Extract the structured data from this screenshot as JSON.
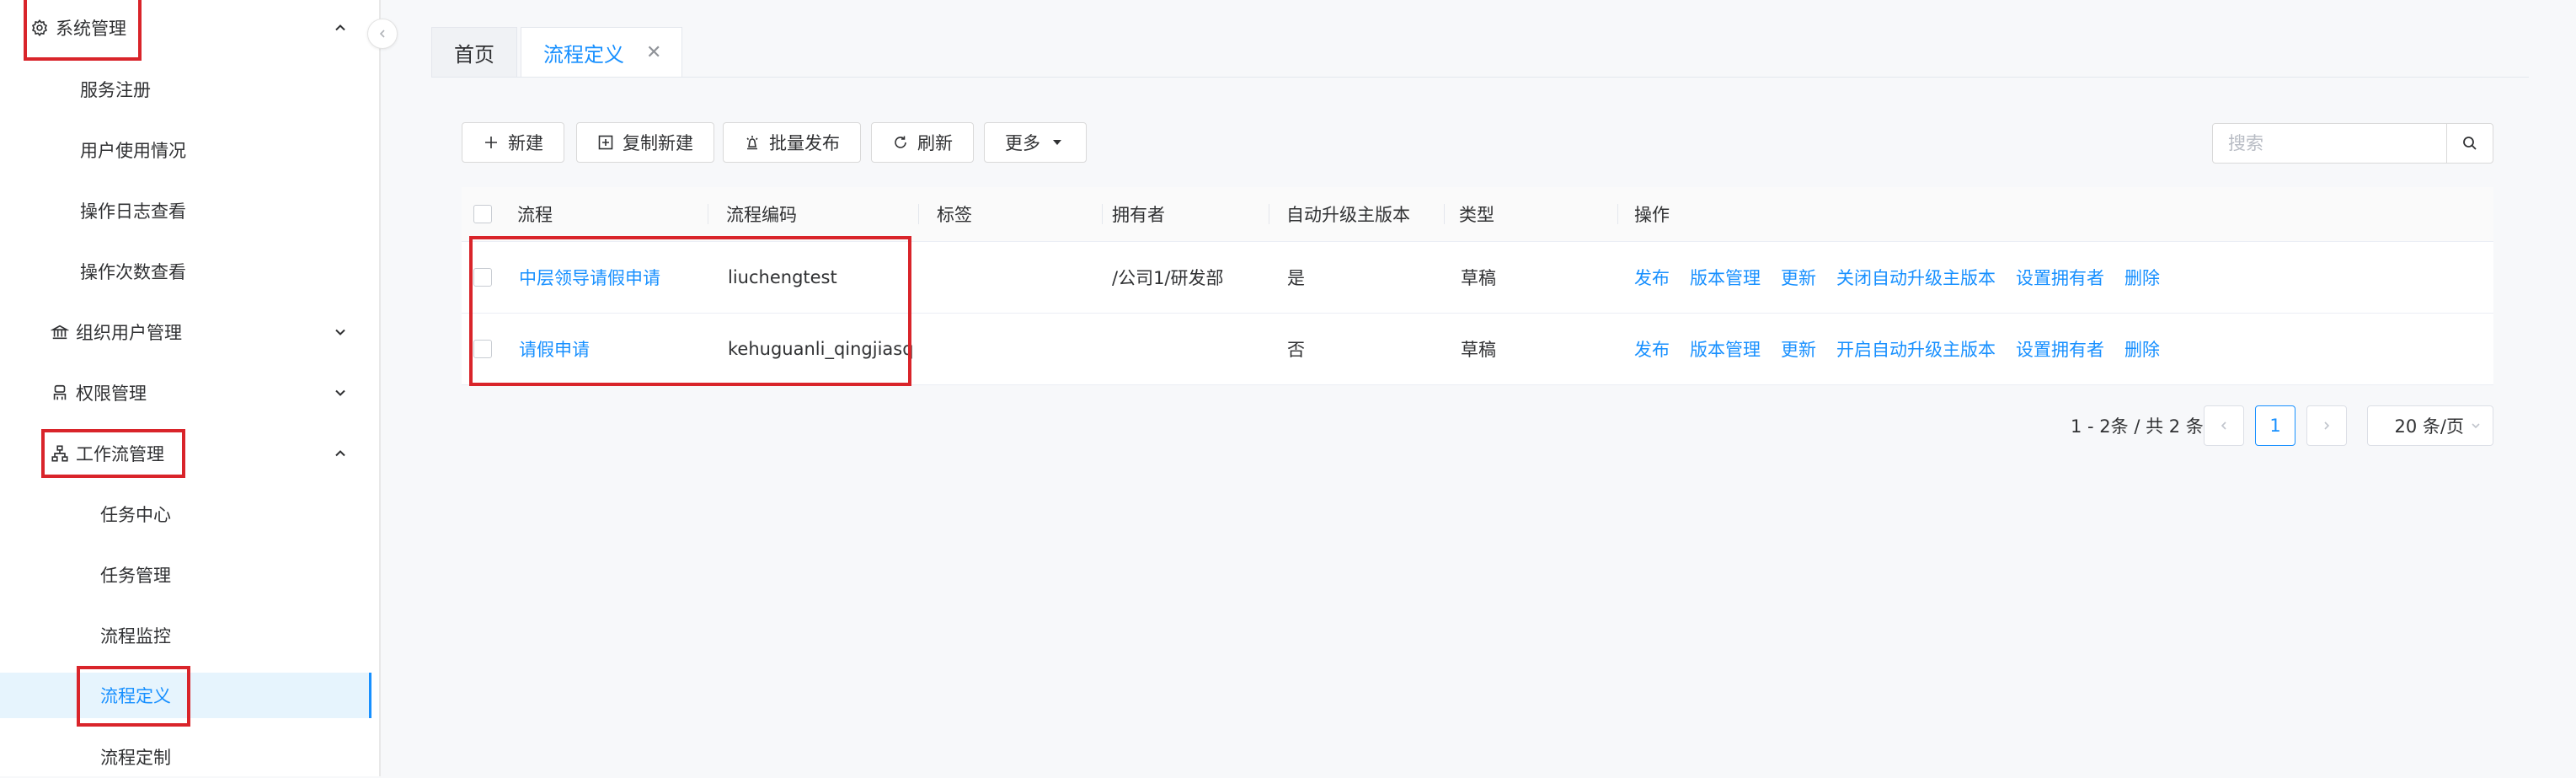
{
  "sidebar": {
    "items": [
      {
        "label": "系统管理"
      },
      {
        "label": "服务注册"
      },
      {
        "label": "用户使用情况"
      },
      {
        "label": "操作日志查看"
      },
      {
        "label": "操作次数查看"
      },
      {
        "label": "组织用户管理"
      },
      {
        "label": "权限管理"
      },
      {
        "label": "工作流管理"
      },
      {
        "label": "任务中心"
      },
      {
        "label": "任务管理"
      },
      {
        "label": "流程监控"
      },
      {
        "label": "流程定义"
      },
      {
        "label": "流程定制"
      }
    ]
  },
  "tabs": [
    {
      "label": "首页"
    },
    {
      "label": "流程定义",
      "close": "✕"
    }
  ],
  "toolbar": {
    "new_label": "新建",
    "copy_new_label": "复制新建",
    "batch_publish_label": "批量发布",
    "refresh_label": "刷新",
    "more_label": "更多"
  },
  "search": {
    "placeholder": "搜索"
  },
  "table": {
    "headers": [
      "流程",
      "流程编码",
      "标签",
      "拥有者",
      "自动升级主版本",
      "类型",
      "操作"
    ],
    "rows": [
      {
        "name": "中层领导请假申请",
        "code": "liuchengtest",
        "tag": "",
        "owner": "/公司1/研发部",
        "auto_upgrade": "是",
        "type": "草稿",
        "actions": [
          "发布",
          "版本管理",
          "更新",
          "关闭自动升级主版本",
          "设置拥有者",
          "删除"
        ]
      },
      {
        "name": "请假申请",
        "code": "kehuguanli_qingjiasq",
        "tag": "",
        "owner": "",
        "auto_upgrade": "否",
        "type": "草稿",
        "actions": [
          "发布",
          "版本管理",
          "更新",
          "开启自动升级主版本",
          "设置拥有者",
          "删除"
        ]
      }
    ]
  },
  "pagination": {
    "total_text": "1 - 2条 / 共 2 条",
    "current_page": "1",
    "page_size": "20 条/页"
  },
  "colors": {
    "accent": "#1890ff",
    "highlight": "#d9242a",
    "active_bg": "#e6f4fd"
  }
}
